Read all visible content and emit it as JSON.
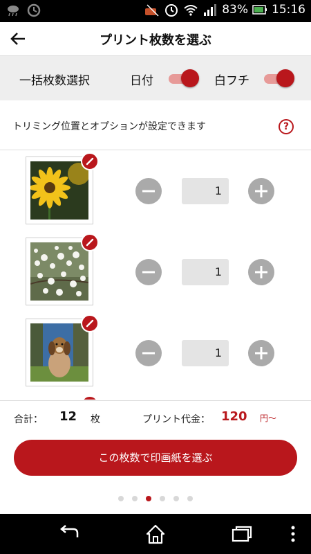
{
  "status": {
    "battery": "83%",
    "time": "15:16"
  },
  "header": {
    "title": "プリント枚数を選ぶ"
  },
  "bulk": {
    "label": "一括枚数選択",
    "date_label": "日付",
    "date_on": true,
    "border_label": "白フチ",
    "border_on": true
  },
  "info": {
    "text": "トリミング位置とオプションが設定できます",
    "help": "?"
  },
  "photos": [
    {
      "subject": "yellow-flower",
      "qty": "1"
    },
    {
      "subject": "white-blossoms",
      "qty": "1"
    },
    {
      "subject": "dog",
      "qty": "1"
    }
  ],
  "summary": {
    "total_label": "合計：",
    "total_count": "12",
    "total_unit": "枚",
    "price_label": "プリント代金：",
    "price_value": "120",
    "price_unit": "円〜"
  },
  "cta": {
    "label": "この枚数で印画紙を選ぶ"
  },
  "pager": {
    "count": 6,
    "active": 2
  },
  "colors": {
    "accent": "#b9171c"
  }
}
